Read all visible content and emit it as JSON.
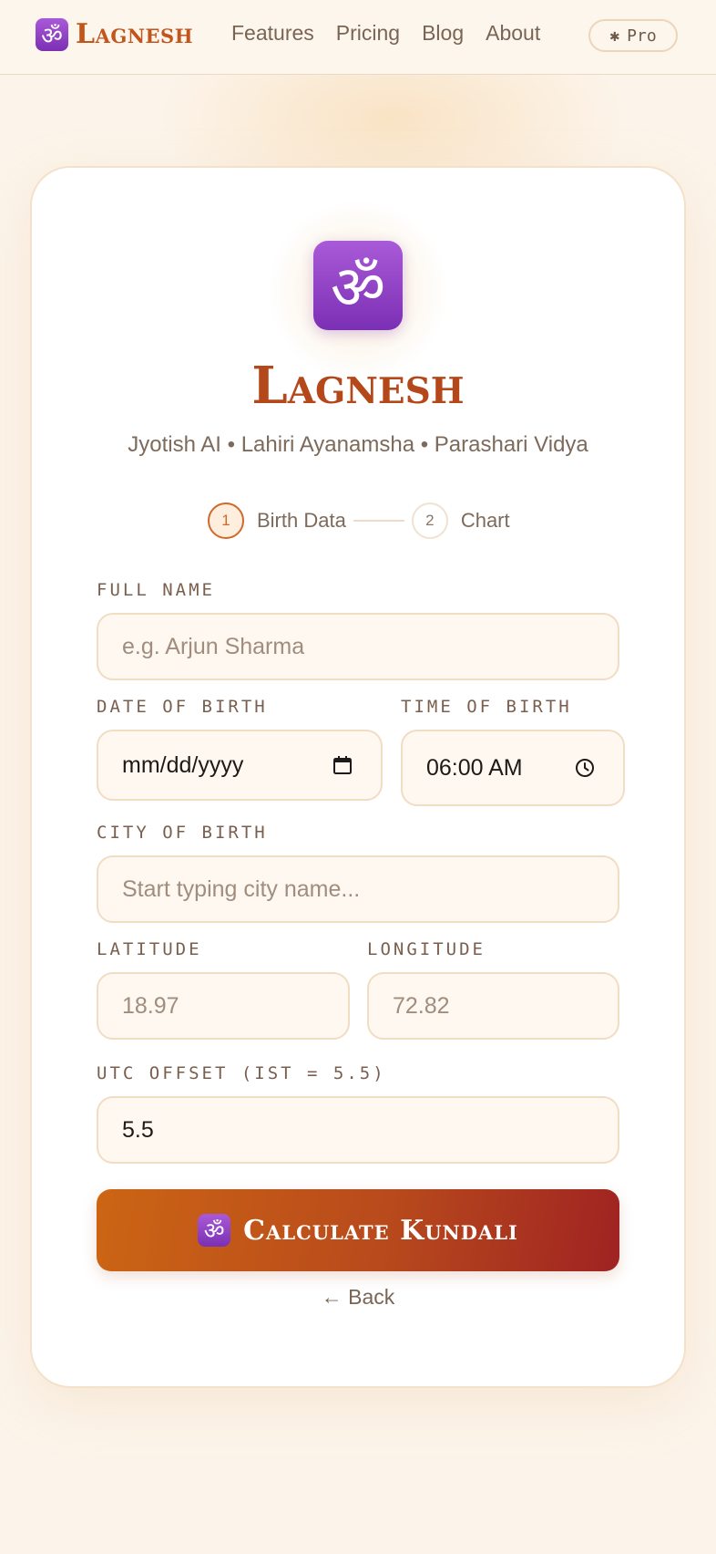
{
  "header": {
    "brand_icon": "om-icon",
    "brand": "Lagnesh",
    "nav": [
      "Features",
      "Pricing",
      "Blog",
      "About"
    ],
    "pro_badge": {
      "icon": "✱",
      "label": "Pro"
    }
  },
  "hero": {
    "logo_icon": "om-icon",
    "title": "Lagnesh",
    "subtitle": "Jyotish AI • Lahiri Ayanamsha • Parashari Vidya"
  },
  "stepper": {
    "steps": [
      {
        "number": "1",
        "label": "Birth Data",
        "active": true
      },
      {
        "number": "2",
        "label": "Chart",
        "active": false
      }
    ]
  },
  "form": {
    "full_name": {
      "label": "FULL NAME",
      "placeholder": "e.g. Arjun Sharma",
      "value": ""
    },
    "date_of_birth": {
      "label": "DATE OF BIRTH",
      "placeholder": "mm/dd/yyyy",
      "value": ""
    },
    "time_of_birth": {
      "label": "TIME OF BIRTH",
      "value": "06:00 AM"
    },
    "city_of_birth": {
      "label": "CITY OF BIRTH",
      "placeholder": "Start typing city name...",
      "value": ""
    },
    "latitude": {
      "label": "LATITUDE",
      "placeholder": "18.97",
      "value": ""
    },
    "longitude": {
      "label": "LONGITUDE",
      "placeholder": "72.82",
      "value": ""
    },
    "utc_offset": {
      "label": "UTC OFFSET (IST = 5.5)",
      "value": "5.5"
    }
  },
  "actions": {
    "submit_label": "Calculate Kundali",
    "back_label": "← Back"
  },
  "colors": {
    "accent": "#c2551a",
    "button_start": "#cc6514",
    "button_end": "#9f2322",
    "om_tile": "#8e3fc6",
    "background": "#fcf4ea"
  }
}
